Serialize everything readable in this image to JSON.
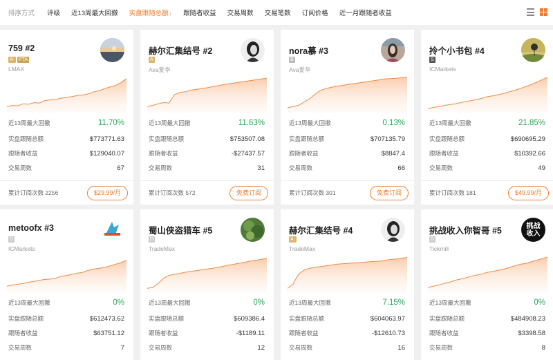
{
  "sortbar": {
    "label": "排序方式",
    "options": [
      {
        "label": "评级"
      },
      {
        "label": "近13周最大回撤"
      },
      {
        "label": "实盘跟随总额",
        "arrow": "↓"
      },
      {
        "label": "跟随者收益"
      },
      {
        "label": "交易周数"
      },
      {
        "label": "交易笔数"
      },
      {
        "label": "订阅价格"
      },
      {
        "label": "近一月跟随者收益"
      }
    ],
    "active_color": "#f07d2e"
  },
  "stat_labels": {
    "drawdown": "近13周最大回撤",
    "follow_total": "实盘跟随总额",
    "follower_profit": "跟随者收益",
    "weeks": "交易周数",
    "subs_prefix": "累计订阅次数"
  },
  "cards": [
    {
      "name": "759 #2",
      "badges": [
        {
          "t": "A-",
          "c": "a"
        },
        {
          "t": "PTA",
          "c": "pta"
        }
      ],
      "broker": "LMAX",
      "drawdown": "11.70%",
      "follow_total": "$773771.63",
      "follower_profit": "$129040.07",
      "weeks": "67",
      "subs": "2256",
      "button": "$29.99/月",
      "avatar": "sunset-avatar"
    },
    {
      "name": "赫尔汇集结号 #2",
      "badges": [
        {
          "t": "A",
          "c": "a"
        }
      ],
      "broker": "Ava爱华",
      "drawdown": "11.63%",
      "follow_total": "$753507.08",
      "follower_profit": "-$27437.57",
      "weeks": "31",
      "subs": "572",
      "button": "免费订阅",
      "avatar": "portrait-avatar"
    },
    {
      "name": "nora慕 #3",
      "badges": [
        {
          "t": "B",
          "c": "b"
        }
      ],
      "broker": "Ava爱华",
      "drawdown": "0.13%",
      "follow_total": "$707135.79",
      "follower_profit": "$8847.4",
      "weeks": "66",
      "subs": "301",
      "button": "免费订阅",
      "avatar": "woman-avatar"
    },
    {
      "name": "拎个小书包 #4",
      "badges": [
        {
          "t": "S",
          "c": "s"
        }
      ],
      "broker": "ICMarkets",
      "drawdown": "21.85%",
      "follow_total": "$690695.29",
      "follower_profit": "$10392.66",
      "weeks": "49",
      "subs": "181",
      "button": "$49.99/月",
      "avatar": "balloon-avatar"
    },
    {
      "name": "metoofx #3",
      "badges": [
        {
          "t": "D",
          "c": "d"
        }
      ],
      "broker": "ICMarkets",
      "drawdown": "0%",
      "follow_total": "$612473.62",
      "follower_profit": "$63751.12",
      "weeks": "7",
      "avatar": "metoo-logo-avatar"
    },
    {
      "name": "蜀山侠盗猎车 #5",
      "badges": [
        {
          "t": "D",
          "c": "d"
        }
      ],
      "broker": "TradeMax",
      "drawdown": "0%",
      "follow_total": "$609386.4",
      "follower_profit": "-$1189.11",
      "weeks": "12",
      "avatar": "grass-avatar"
    },
    {
      "name": "赫尔汇集结号 #4",
      "badges": [
        {
          "t": "A-",
          "c": "a"
        }
      ],
      "broker": "TradeMax",
      "drawdown": "7.15%",
      "follow_total": "$604063.97",
      "follower_profit": "-$12610.73",
      "weeks": "16",
      "avatar": "portrait-avatar"
    },
    {
      "name": "挑战收入你智哥 #5",
      "badges": [
        {
          "t": "D",
          "c": "d"
        }
      ],
      "broker": "Tickmill",
      "drawdown": "0%",
      "follow_total": "$484908.23",
      "follower_profit": "$3398.58",
      "weeks": "8",
      "avatar": "challenge-text-avatar",
      "avatar_text": [
        "挑战",
        "收入"
      ]
    }
  ],
  "sparklines": [
    [
      0.15,
      0.18,
      0.17,
      0.22,
      0.21,
      0.25,
      0.24,
      0.3,
      0.32,
      0.33,
      0.36,
      0.38,
      0.4,
      0.43,
      0.44,
      0.47,
      0.52,
      0.55,
      0.6,
      0.64,
      0.68,
      0.75,
      0.85
    ],
    [
      0.15,
      0.18,
      0.22,
      0.25,
      0.24,
      0.45,
      0.5,
      0.52,
      0.56,
      0.58,
      0.6,
      0.62,
      0.65,
      0.67,
      0.7,
      0.72,
      0.74,
      0.76,
      0.78,
      0.8,
      0.82,
      0.84,
      0.86
    ],
    [
      0.12,
      0.15,
      0.18,
      0.26,
      0.34,
      0.45,
      0.55,
      0.6,
      0.63,
      0.66,
      0.68,
      0.7,
      0.72,
      0.74,
      0.76,
      0.78,
      0.8,
      0.82,
      0.84,
      0.85,
      0.86,
      0.87,
      0.88
    ],
    [
      0.1,
      0.13,
      0.15,
      0.18,
      0.2,
      0.22,
      0.25,
      0.28,
      0.3,
      0.33,
      0.36,
      0.4,
      0.42,
      0.45,
      0.48,
      0.52,
      0.56,
      0.6,
      0.65,
      0.7,
      0.76,
      0.82,
      0.88
    ],
    [
      0.15,
      0.18,
      0.2,
      0.22,
      0.25,
      0.27,
      0.3,
      0.32,
      0.33,
      0.35,
      0.4,
      0.42,
      0.45,
      0.48,
      0.5,
      0.55,
      0.58,
      0.6,
      0.62,
      0.66,
      0.7,
      0.74,
      0.8
    ],
    [
      0.1,
      0.12,
      0.22,
      0.35,
      0.42,
      0.45,
      0.47,
      0.5,
      0.52,
      0.54,
      0.56,
      0.58,
      0.6,
      0.62,
      0.65,
      0.68,
      0.7,
      0.73,
      0.75,
      0.78,
      0.8,
      0.82,
      0.85
    ],
    [
      0.1,
      0.2,
      0.45,
      0.55,
      0.6,
      0.62,
      0.64,
      0.66,
      0.68,
      0.7,
      0.71,
      0.72,
      0.73,
      0.74,
      0.75,
      0.76,
      0.77,
      0.78,
      0.8,
      0.82,
      0.83,
      0.85,
      0.87
    ],
    [
      0.12,
      0.15,
      0.18,
      0.22,
      0.25,
      0.3,
      0.33,
      0.36,
      0.4,
      0.43,
      0.46,
      0.5,
      0.52,
      0.55,
      0.58,
      0.62,
      0.66,
      0.7,
      0.72,
      0.76,
      0.8,
      0.84,
      0.88
    ]
  ]
}
